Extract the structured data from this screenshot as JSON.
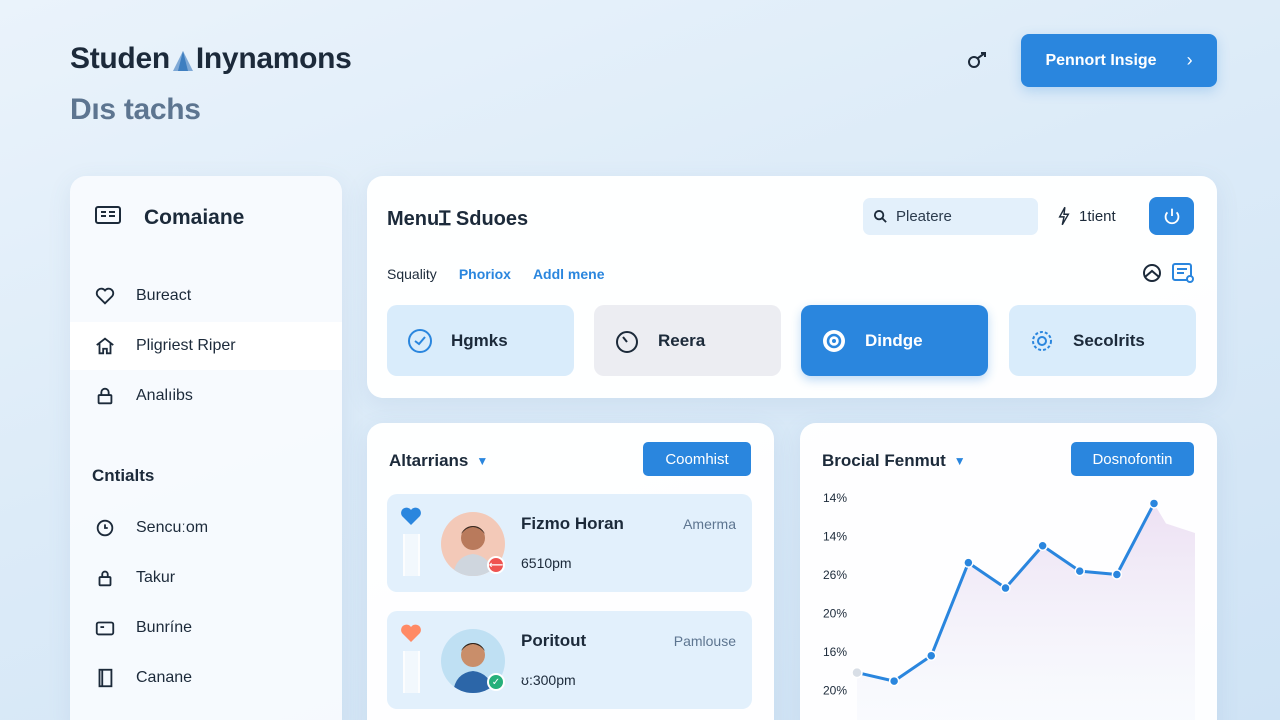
{
  "header": {
    "title_part1": "Studen",
    "title_part2": "Inynamons",
    "subtitle": "Dıs tachs",
    "primary_button": "Pennort Insige"
  },
  "sidebar": {
    "title": "Comaiane",
    "items": [
      {
        "label": "Bureact",
        "icon": "heart-icon"
      },
      {
        "label": "Pligriest Riper",
        "icon": "home-icon",
        "active": true
      },
      {
        "label": "Analıibs",
        "icon": "lock-icon"
      }
    ],
    "section_title": "Cntialts",
    "section_items": [
      {
        "label": "Sencuːom",
        "icon": "clock-icon"
      },
      {
        "label": "Takur",
        "icon": "lock-icon"
      },
      {
        "label": "Bunríne",
        "icon": "card-icon"
      },
      {
        "label": "Canane",
        "icon": "document-icon"
      }
    ]
  },
  "top_card": {
    "title": "MenuꞮ Sduoes",
    "search_placeholder": "Pleatere",
    "filter_label": "1tient",
    "tabs": [
      "Squality",
      "Phoriox",
      "Addl mene"
    ],
    "tiles": [
      {
        "label": "Hgmks",
        "icon": "clock-icon",
        "style": "light"
      },
      {
        "label": "Reera",
        "icon": "timer-icon",
        "style": "grey"
      },
      {
        "label": "Dindge",
        "icon": "target-icon",
        "style": "blue"
      },
      {
        "label": "Secolrits",
        "icon": "shield-icon",
        "style": "light"
      }
    ]
  },
  "list_card": {
    "title": "Altarrians",
    "button": "Coomhist",
    "rows": [
      {
        "name": "Fizmo Horan",
        "time": "6510pm",
        "tag": "Amerma",
        "heart_color": "#2a86de",
        "badge_color": "#ef5350"
      },
      {
        "name": "Poritout",
        "time": "ʊ:300pm",
        "tag": "Pamlouse",
        "heart_color": "#ff8a65",
        "badge_color": "#26b07a"
      }
    ]
  },
  "chart_card": {
    "title": "Brocial Fenmut",
    "button": "Dosnofontin"
  },
  "chart_data": {
    "type": "line",
    "y_tick_labels": [
      "14%",
      "14%",
      "26%",
      "20%",
      "16%",
      "20%"
    ],
    "values": [
      20.5,
      20,
      21.5,
      27,
      25.5,
      28,
      26.5,
      26.3,
      30.5
    ],
    "color": "#2a86de"
  },
  "colors": {
    "accent": "#2a86de",
    "background": "#dcebf8",
    "text": "#1c2a3a"
  }
}
